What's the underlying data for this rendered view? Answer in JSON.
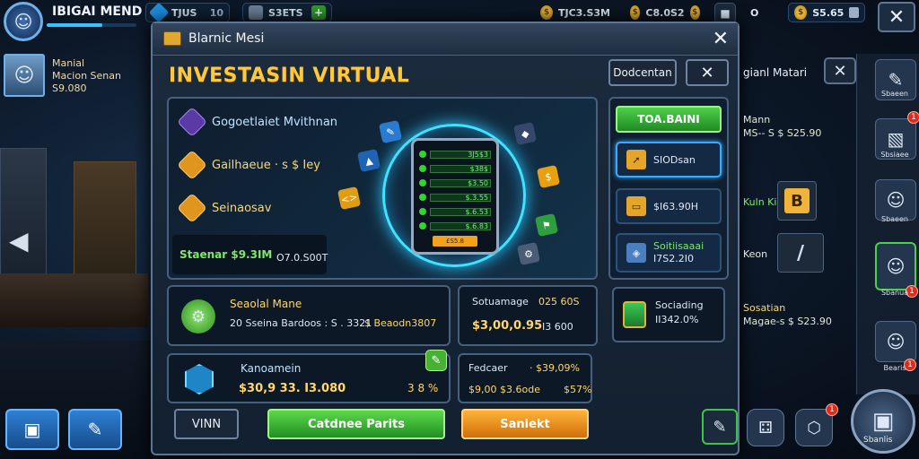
{
  "top": {
    "player_name": "IBIGAI MEND",
    "pill1_text": "TJUS",
    "pill1_small": "10",
    "pill2_text": "S3ETS",
    "coin1": "TJC3.S3M",
    "coin2": "C8.0S2",
    "coin3": "O",
    "coin4": "S5.65",
    "xp_percent": 62
  },
  "left": {
    "card_name": "Manial",
    "card_line2": "Macion Senan",
    "card_value": "S9.080"
  },
  "panel": {
    "title": "Blarnic Mesi",
    "heading": "INVESTASIN VIRTUAL",
    "btn_header": "Dodcentan",
    "features": [
      {
        "label": "Gogoetlaiet Mvithnan"
      },
      {
        "label": "Gailhaeue · s $ Iey"
      },
      {
        "label": "Seinaosav"
      }
    ],
    "strip_label": "Staenar $9.3IM",
    "strip_value": "O7.0.S00T",
    "phone_rows": [
      "3J5$3",
      "$38$",
      "$3.50",
      "$.3.55",
      "$.6.53",
      "$.6.83"
    ],
    "phone_btn": "£S5.8",
    "cube_icons": [
      "pen-icon",
      "chart-icon",
      "cube-icon",
      "coin-icon",
      "code-icon",
      "flag-icon",
      "gear-icon"
    ],
    "right_btns": {
      "top_button": "TOA.BAINI",
      "item1": "SIODsan",
      "item2": "$I63.90H",
      "item3_title": "Soitiisaaai",
      "item3_value": "I7S2.2I0"
    },
    "sec_box1": {
      "title": "Seaolal Mane",
      "line": "20 Sseina Bardoos : S . 3321",
      "line2": "$ Beaodn3807"
    },
    "sec_box2": {
      "title": "Sotuamage",
      "title_val": "025 60S",
      "value": "$3,00,0.95",
      "value2": "I3 600"
    },
    "sec_box3": {
      "title": "Sociading",
      "value": "II342.0%"
    },
    "bottom_box1": {
      "title": "Kanoamein",
      "value": "$30,9 33. I3.080",
      "pct": "3 8 %"
    },
    "bottom_box2": {
      "title": "Fedcaer",
      "title_val": "· $39,09%",
      "value": "$9,00 $3.6ode",
      "pct": "$57%"
    },
    "btn_vinn": "VINN",
    "btn_green": "Catdnee Parits",
    "btn_orange": "Saniekt"
  },
  "right": {
    "title": "gianl Matari",
    "rows": [
      {
        "line1": "Mann",
        "line2": "MS-- S $ S25.90"
      },
      {
        "line1": "Kuln Kia",
        "line2": ""
      },
      {
        "line1": "Keon",
        "line2": ""
      },
      {
        "line1": "Sosatian",
        "line2": "Magae-s $ S23.90"
      }
    ],
    "box_letter": "B",
    "side_labels": [
      "Sbaeen",
      "Sbsiaee",
      "Sbaeen",
      "Sbanua",
      "Sbanlis",
      "Bearis"
    ],
    "badge_count": "1"
  }
}
